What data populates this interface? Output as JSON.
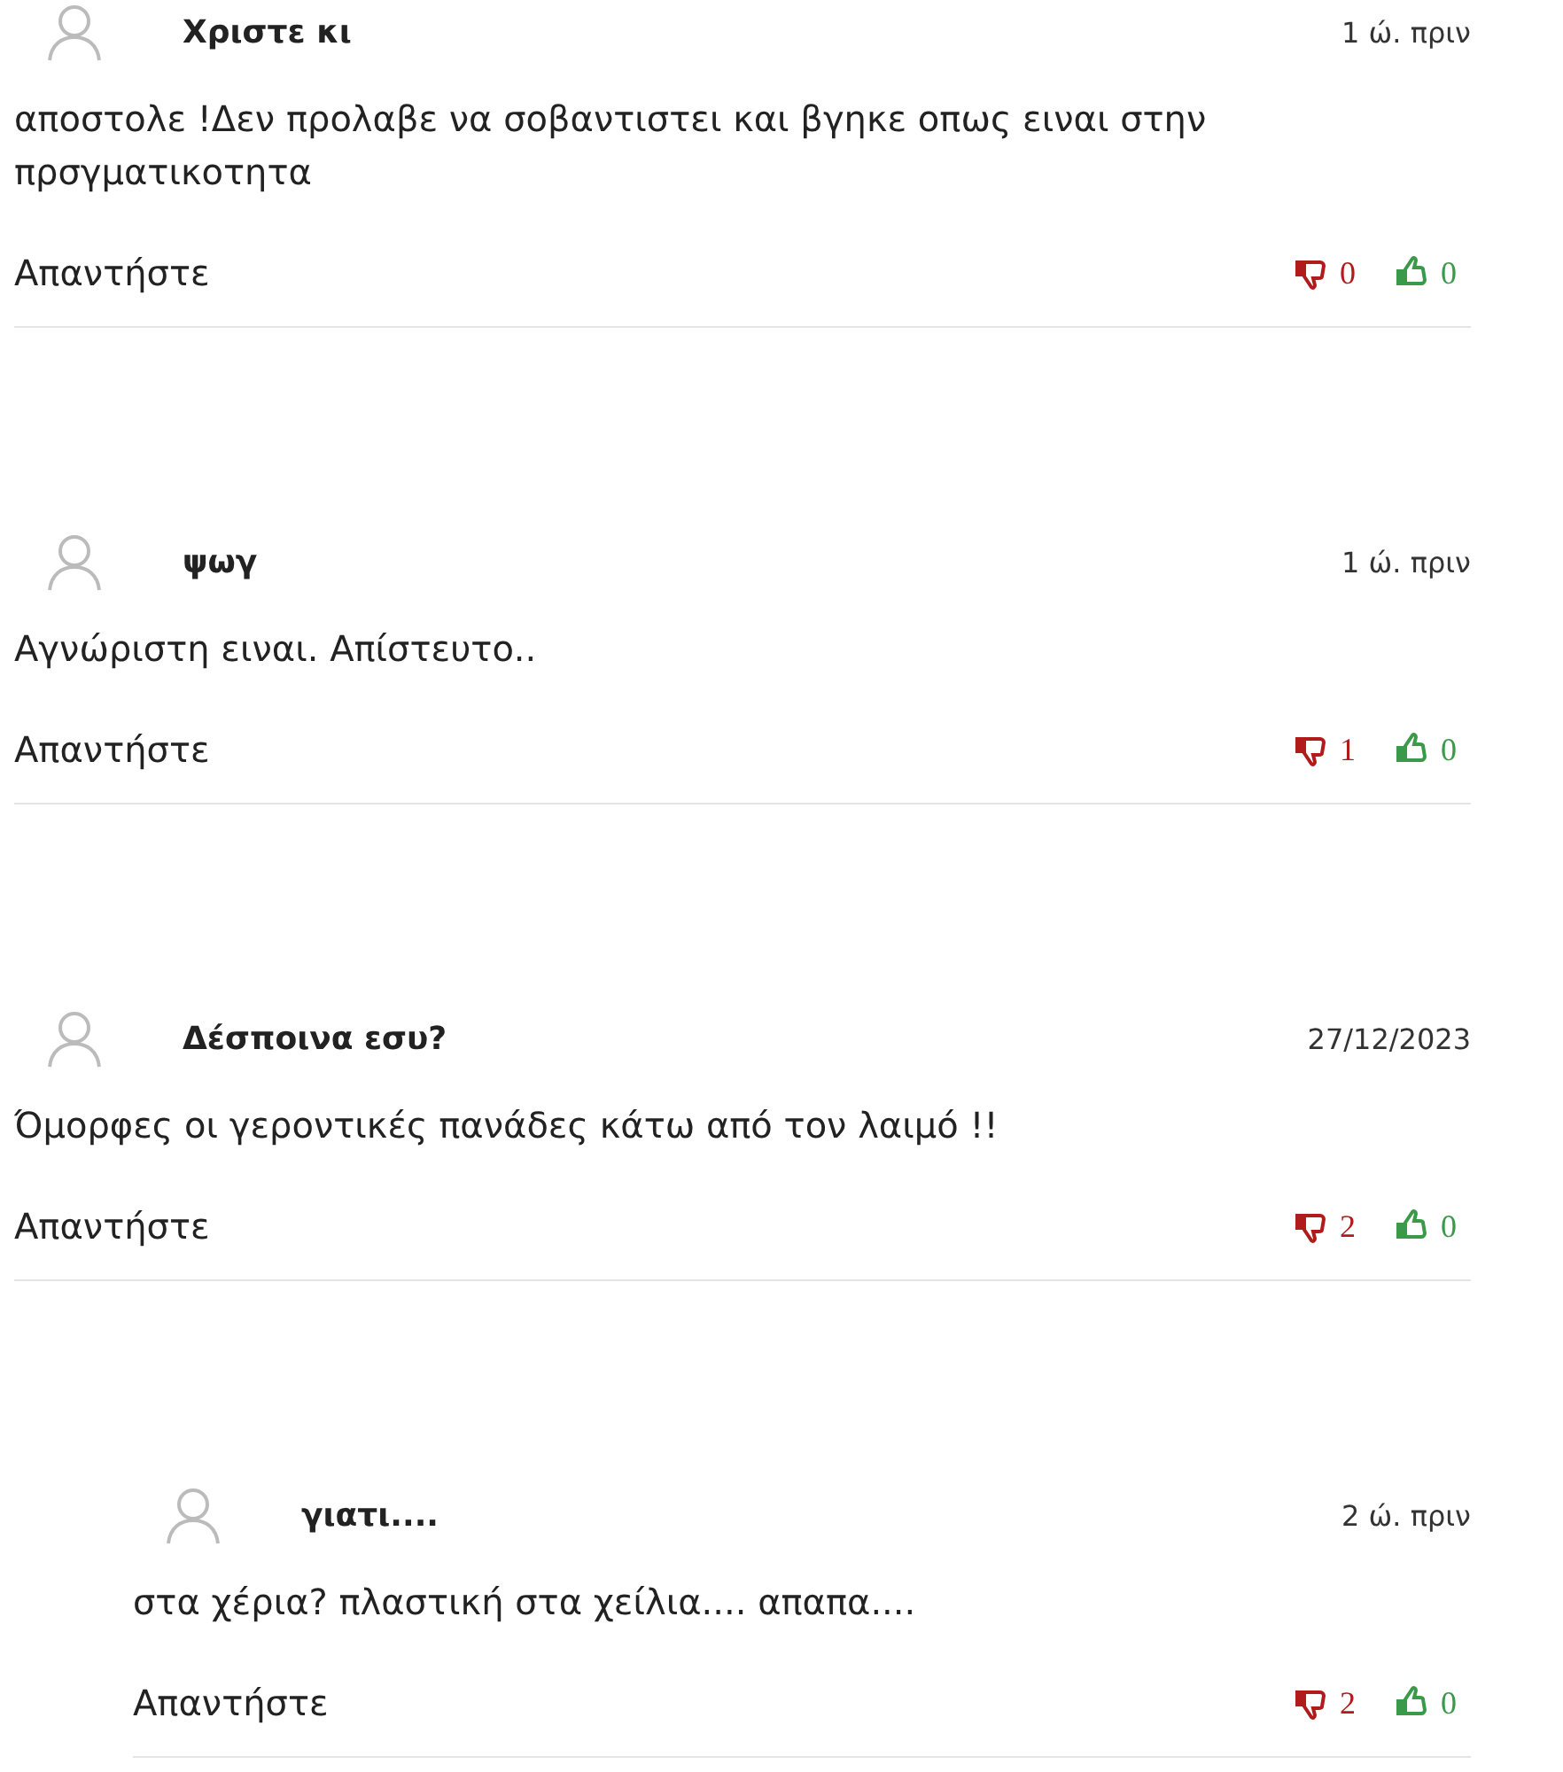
{
  "comments": [
    {
      "author": "Χριστε κι",
      "time": "1 ώ. πριν",
      "text": "αποστολε !Δεν προλαβε να σοβαντιστει και βγηκε οπως ειναι στην πρσγματικοτητα",
      "reply_label": "Απαντήστε",
      "dislikes": "0",
      "likes": "0"
    },
    {
      "author": "ψωγ",
      "time": "1 ώ. πριν",
      "text": "Αγνώριστη ειναι. Απίστευτο..",
      "reply_label": "Απαντήστε",
      "dislikes": "1",
      "likes": "0"
    },
    {
      "author": "Δέσποινα εσυ?",
      "time": "27/12/2023",
      "text": "Όμορφες οι γεροντικές πανάδες κάτω από τον λαιμό !!",
      "reply_label": "Απαντήστε",
      "dislikes": "2",
      "likes": "0",
      "children": [
        {
          "author": "γιατι....",
          "time": "2 ώ. πριν",
          "text": "στα χέρια? πλαστική στα χείλια.... απαπα....",
          "reply_label": "Απαντήστε",
          "dislikes": "2",
          "likes": "0"
        }
      ]
    }
  ]
}
